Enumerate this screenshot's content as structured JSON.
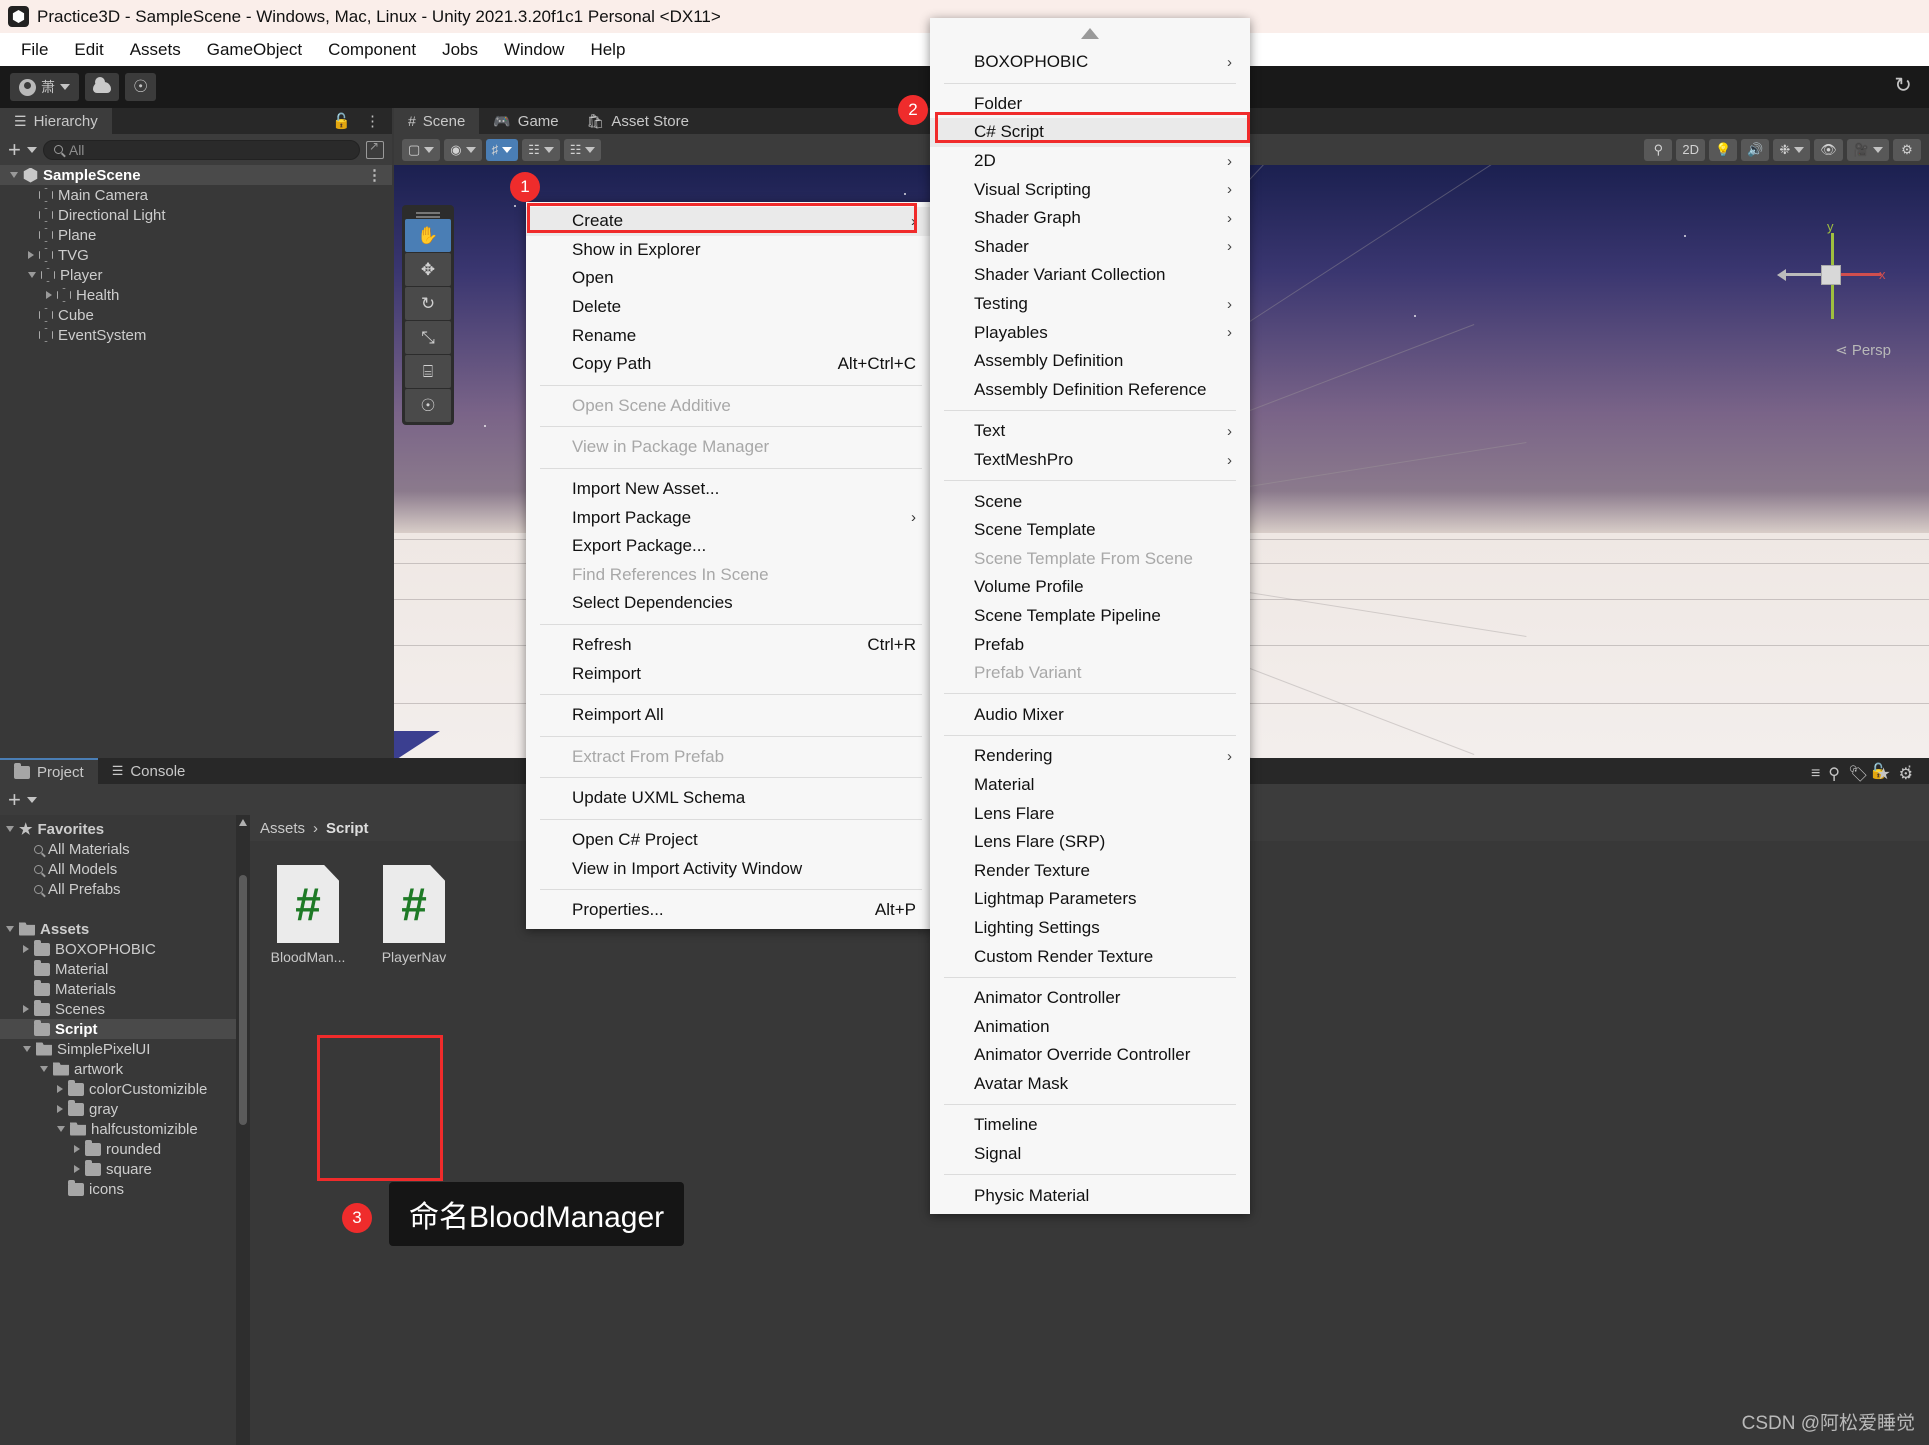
{
  "window": {
    "title": "Practice3D - SampleScene - Windows, Mac, Linux - Unity 2021.3.20f1c1 Personal <DX11>",
    "logo_icon": "unity-logo-icon"
  },
  "menubar": {
    "items": [
      "File",
      "Edit",
      "Assets",
      "GameObject",
      "Component",
      "Jobs",
      "Window",
      "Help"
    ]
  },
  "toolbar": {
    "account_label": "萧",
    "cloud_icon": "cloud-icon",
    "collab_icon": "collab-icon",
    "history_icon": "history-icon"
  },
  "hierarchy": {
    "tab_label": "Hierarchy",
    "tab_icon": "hierarchy-icon",
    "lock_icon": "lock-icon",
    "kebab_icon": "kebab-menu-icon",
    "add_label": "+",
    "search": {
      "placeholder": "All",
      "value": ""
    },
    "search_icon": "search-icon",
    "expand_icon": "expand-window-icon",
    "tree": [
      {
        "label": "SampleScene",
        "depth": 0,
        "toggle": "open",
        "icon": "scene-icon",
        "selected": true
      },
      {
        "label": "Main Camera",
        "depth": 1,
        "toggle": "none",
        "icon": "cube-icon",
        "selected": false
      },
      {
        "label": "Directional Light",
        "depth": 1,
        "toggle": "none",
        "icon": "cube-icon",
        "selected": false
      },
      {
        "label": "Plane",
        "depth": 1,
        "toggle": "none",
        "icon": "cube-icon",
        "selected": false
      },
      {
        "label": "TVG",
        "depth": 1,
        "toggle": "closed",
        "icon": "cube-icon",
        "selected": false
      },
      {
        "label": "Player",
        "depth": 1,
        "toggle": "open",
        "icon": "cube-icon",
        "selected": false
      },
      {
        "label": "Health",
        "depth": 2,
        "toggle": "closed",
        "icon": "cube-icon",
        "selected": false
      },
      {
        "label": "Cube",
        "depth": 1,
        "toggle": "none",
        "icon": "cube-icon",
        "selected": false
      },
      {
        "label": "EventSystem",
        "depth": 1,
        "toggle": "none",
        "icon": "cube-icon",
        "selected": false
      }
    ]
  },
  "sceneview": {
    "tabs": [
      {
        "label": "Scene",
        "icon": "grid-icon",
        "active": true
      },
      {
        "label": "Game",
        "icon": "gamepad-icon",
        "active": false
      },
      {
        "label": "Asset Store",
        "icon": "shopping-bag-icon",
        "active": false
      }
    ],
    "lock_icon": "lock-icon",
    "kebab_icon": "kebab-menu-icon",
    "toolbar_buttons": [
      "shaded-mode",
      "2d-toggle",
      "lighting-toggle",
      "audio-toggle",
      "fx-toggle",
      "hidden-toggle",
      "camera-toggle",
      "gizmos-toggle"
    ],
    "right_buttons": [
      "2D",
      "lighting-icon",
      "audio-icon",
      "fx-icon",
      "visibility-off-icon",
      "camera-icon",
      "gizmos-icon"
    ],
    "twod_label": "2D",
    "gizmo": {
      "axis_y": "y",
      "axis_x": "x",
      "persp_label": "Persp"
    }
  },
  "tool_palette": {
    "items": [
      "hand-tool",
      "move-tool",
      "rotate-tool",
      "scale-tool",
      "rect-tool",
      "transform-tool"
    ],
    "selected_index": 0
  },
  "context_menu": {
    "items": [
      {
        "label": "Create",
        "submenu": true,
        "disabled": false,
        "highlight": true,
        "shortcut": ""
      },
      {
        "label": "Show in Explorer",
        "submenu": false,
        "disabled": false,
        "highlight": false,
        "shortcut": ""
      },
      {
        "label": "Open",
        "submenu": false,
        "disabled": false,
        "highlight": false,
        "shortcut": ""
      },
      {
        "label": "Delete",
        "submenu": false,
        "disabled": false,
        "highlight": false,
        "shortcut": ""
      },
      {
        "label": "Rename",
        "submenu": false,
        "disabled": false,
        "highlight": false,
        "shortcut": ""
      },
      {
        "label": "Copy Path",
        "submenu": false,
        "disabled": false,
        "highlight": false,
        "shortcut": "Alt+Ctrl+C"
      },
      {
        "separator": true
      },
      {
        "label": "Open Scene Additive",
        "submenu": false,
        "disabled": true,
        "highlight": false,
        "shortcut": ""
      },
      {
        "separator": true
      },
      {
        "label": "View in Package Manager",
        "submenu": false,
        "disabled": true,
        "highlight": false,
        "shortcut": ""
      },
      {
        "separator": true
      },
      {
        "label": "Import New Asset...",
        "submenu": false,
        "disabled": false,
        "highlight": false,
        "shortcut": ""
      },
      {
        "label": "Import Package",
        "submenu": true,
        "disabled": false,
        "highlight": false,
        "shortcut": ""
      },
      {
        "label": "Export Package...",
        "submenu": false,
        "disabled": false,
        "highlight": false,
        "shortcut": ""
      },
      {
        "label": "Find References In Scene",
        "submenu": false,
        "disabled": true,
        "highlight": false,
        "shortcut": ""
      },
      {
        "label": "Select Dependencies",
        "submenu": false,
        "disabled": false,
        "highlight": false,
        "shortcut": ""
      },
      {
        "separator": true
      },
      {
        "label": "Refresh",
        "submenu": false,
        "disabled": false,
        "highlight": false,
        "shortcut": "Ctrl+R"
      },
      {
        "label": "Reimport",
        "submenu": false,
        "disabled": false,
        "highlight": false,
        "shortcut": ""
      },
      {
        "separator": true
      },
      {
        "label": "Reimport All",
        "submenu": false,
        "disabled": false,
        "highlight": false,
        "shortcut": ""
      },
      {
        "separator": true
      },
      {
        "label": "Extract From Prefab",
        "submenu": false,
        "disabled": true,
        "highlight": false,
        "shortcut": ""
      },
      {
        "separator": true
      },
      {
        "label": "Update UXML Schema",
        "submenu": false,
        "disabled": false,
        "highlight": false,
        "shortcut": ""
      },
      {
        "separator": true
      },
      {
        "label": "Open C# Project",
        "submenu": false,
        "disabled": false,
        "highlight": false,
        "shortcut": ""
      },
      {
        "label": "View in Import Activity Window",
        "submenu": false,
        "disabled": false,
        "highlight": false,
        "shortcut": ""
      },
      {
        "separator": true
      },
      {
        "label": "Properties...",
        "submenu": false,
        "disabled": false,
        "highlight": false,
        "shortcut": "Alt+P"
      }
    ]
  },
  "create_submenu": {
    "scroll_up_icon": "scroll-up-arrow-icon",
    "items": [
      {
        "label": "BOXOPHOBIC",
        "submenu": true,
        "disabled": false,
        "highlight": false
      },
      {
        "separator": true
      },
      {
        "label": "Folder",
        "submenu": false,
        "disabled": false,
        "highlight": false
      },
      {
        "label": "C# Script",
        "submenu": false,
        "disabled": false,
        "highlight": true
      },
      {
        "label": "2D",
        "submenu": true,
        "disabled": false,
        "highlight": false
      },
      {
        "label": "Visual Scripting",
        "submenu": true,
        "disabled": false,
        "highlight": false
      },
      {
        "label": "Shader Graph",
        "submenu": true,
        "disabled": false,
        "highlight": false
      },
      {
        "label": "Shader",
        "submenu": true,
        "disabled": false,
        "highlight": false
      },
      {
        "label": "Shader Variant Collection",
        "submenu": false,
        "disabled": false,
        "highlight": false
      },
      {
        "label": "Testing",
        "submenu": true,
        "disabled": false,
        "highlight": false
      },
      {
        "label": "Playables",
        "submenu": true,
        "disabled": false,
        "highlight": false
      },
      {
        "label": "Assembly Definition",
        "submenu": false,
        "disabled": false,
        "highlight": false
      },
      {
        "label": "Assembly Definition Reference",
        "submenu": false,
        "disabled": false,
        "highlight": false
      },
      {
        "separator": true
      },
      {
        "label": "Text",
        "submenu": true,
        "disabled": false,
        "highlight": false
      },
      {
        "label": "TextMeshPro",
        "submenu": true,
        "disabled": false,
        "highlight": false
      },
      {
        "separator": true
      },
      {
        "label": "Scene",
        "submenu": false,
        "disabled": false,
        "highlight": false
      },
      {
        "label": "Scene Template",
        "submenu": false,
        "disabled": false,
        "highlight": false
      },
      {
        "label": "Scene Template From Scene",
        "submenu": false,
        "disabled": true,
        "highlight": false
      },
      {
        "label": "Volume Profile",
        "submenu": false,
        "disabled": false,
        "highlight": false
      },
      {
        "label": "Scene Template Pipeline",
        "submenu": false,
        "disabled": false,
        "highlight": false
      },
      {
        "label": "Prefab",
        "submenu": false,
        "disabled": false,
        "highlight": false
      },
      {
        "label": "Prefab Variant",
        "submenu": false,
        "disabled": true,
        "highlight": false
      },
      {
        "separator": true
      },
      {
        "label": "Audio Mixer",
        "submenu": false,
        "disabled": false,
        "highlight": false
      },
      {
        "separator": true
      },
      {
        "label": "Rendering",
        "submenu": true,
        "disabled": false,
        "highlight": false
      },
      {
        "label": "Material",
        "submenu": false,
        "disabled": false,
        "highlight": false
      },
      {
        "label": "Lens Flare",
        "submenu": false,
        "disabled": false,
        "highlight": false
      },
      {
        "label": "Lens Flare (SRP)",
        "submenu": false,
        "disabled": false,
        "highlight": false
      },
      {
        "label": "Render Texture",
        "submenu": false,
        "disabled": false,
        "highlight": false
      },
      {
        "label": "Lightmap Parameters",
        "submenu": false,
        "disabled": false,
        "highlight": false
      },
      {
        "label": "Lighting Settings",
        "submenu": false,
        "disabled": false,
        "highlight": false
      },
      {
        "label": "Custom Render Texture",
        "submenu": false,
        "disabled": false,
        "highlight": false
      },
      {
        "separator": true
      },
      {
        "label": "Animator Controller",
        "submenu": false,
        "disabled": false,
        "highlight": false
      },
      {
        "label": "Animation",
        "submenu": false,
        "disabled": false,
        "highlight": false
      },
      {
        "label": "Animator Override Controller",
        "submenu": false,
        "disabled": false,
        "highlight": false
      },
      {
        "label": "Avatar Mask",
        "submenu": false,
        "disabled": false,
        "highlight": false
      },
      {
        "separator": true
      },
      {
        "label": "Timeline",
        "submenu": false,
        "disabled": false,
        "highlight": false
      },
      {
        "label": "Signal",
        "submenu": false,
        "disabled": false,
        "highlight": false
      },
      {
        "separator": true
      },
      {
        "label": "Physic Material",
        "submenu": false,
        "disabled": false,
        "highlight": false
      }
    ]
  },
  "project": {
    "tabs": [
      {
        "label": "Project",
        "icon": "folder-icon",
        "active": true
      },
      {
        "label": "Console",
        "icon": "console-icon",
        "active": false
      }
    ],
    "add_label": "+",
    "lock_icon": "lock-icon",
    "kebab_icon": "kebab-menu-icon",
    "breadcrumb": [
      "Assets",
      "Script"
    ],
    "tree": [
      {
        "label": "Favorites",
        "depth": 0,
        "toggle": "open",
        "icon": "star-icon",
        "bold": true
      },
      {
        "label": "All Materials",
        "depth": 1,
        "toggle": "none",
        "icon": "search-icon",
        "bold": false
      },
      {
        "label": "All Models",
        "depth": 1,
        "toggle": "none",
        "icon": "search-icon",
        "bold": false
      },
      {
        "label": "All Prefabs",
        "depth": 1,
        "toggle": "none",
        "icon": "search-icon",
        "bold": false
      },
      {
        "label": "",
        "depth": 0,
        "toggle": "none",
        "icon": "none",
        "bold": false
      },
      {
        "label": "Assets",
        "depth": 0,
        "toggle": "open",
        "icon": "folder-open-icon",
        "bold": true
      },
      {
        "label": "BOXOPHOBIC",
        "depth": 1,
        "toggle": "closed",
        "icon": "folder-icon",
        "bold": false
      },
      {
        "label": "Material",
        "depth": 1,
        "toggle": "none",
        "icon": "folder-icon",
        "bold": false
      },
      {
        "label": "Materials",
        "depth": 1,
        "toggle": "none",
        "icon": "folder-icon",
        "bold": false
      },
      {
        "label": "Scenes",
        "depth": 1,
        "toggle": "closed",
        "icon": "folder-icon",
        "bold": false
      },
      {
        "label": "Script",
        "depth": 1,
        "toggle": "none",
        "icon": "folder-icon",
        "bold": false,
        "selected": true
      },
      {
        "label": "SimplePixelUI",
        "depth": 1,
        "toggle": "open",
        "icon": "folder-open-icon",
        "bold": false
      },
      {
        "label": "artwork",
        "depth": 2,
        "toggle": "open",
        "icon": "folder-open-icon",
        "bold": false
      },
      {
        "label": "colorCustomizible",
        "depth": 3,
        "toggle": "closed",
        "icon": "folder-icon",
        "bold": false
      },
      {
        "label": "gray",
        "depth": 3,
        "toggle": "closed",
        "icon": "folder-icon",
        "bold": false
      },
      {
        "label": "halfcustomizible",
        "depth": 3,
        "toggle": "open",
        "icon": "folder-open-icon",
        "bold": false
      },
      {
        "label": "rounded",
        "depth": 4,
        "toggle": "closed",
        "icon": "folder-icon",
        "bold": false
      },
      {
        "label": "square",
        "depth": 4,
        "toggle": "closed",
        "icon": "folder-icon",
        "bold": false
      },
      {
        "label": "icons",
        "depth": 3,
        "toggle": "none",
        "icon": "folder-icon",
        "bold": false
      }
    ],
    "assets": [
      {
        "label": "BloodMan...",
        "icon": "csharp-script-icon",
        "glyph": "#",
        "selected": true
      },
      {
        "label": "PlayerNav",
        "icon": "csharp-script-icon",
        "glyph": "#",
        "selected": false
      }
    ]
  },
  "annotations": {
    "badges": [
      {
        "number": "1"
      },
      {
        "number": "2"
      },
      {
        "number": "3"
      }
    ],
    "callout_text": "命名BloodManager",
    "highlight_color": "#f02b2b"
  },
  "watermark": "CSDN @阿松爱睡觉"
}
